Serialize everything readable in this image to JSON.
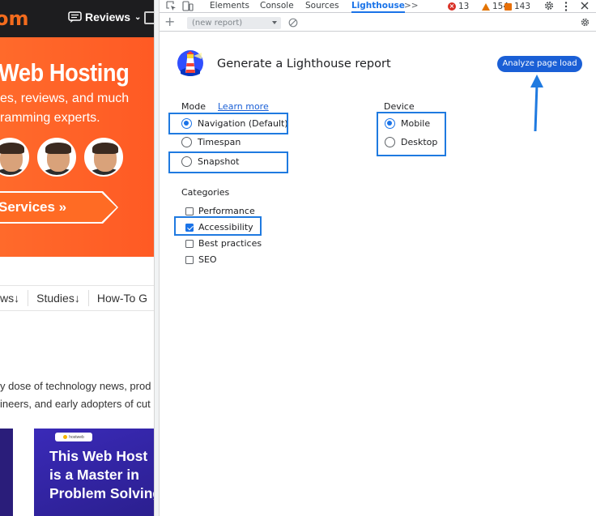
{
  "website": {
    "logo": "om",
    "nav_reviews": "Reviews",
    "hero_title": "Web Hosting",
    "hero_line1": "es, reviews, and much",
    "hero_line2": "ramming experts.",
    "services_button": "Services »",
    "subnav": [
      "ws↓",
      "Studies↓",
      "How-To G"
    ],
    "text_line1": "y dose of technology news, prod",
    "text_line2": "ineers, and early adopters of cut",
    "card_badge": "hostweb",
    "card_title": "This Web Host is a Master in Problem Solving"
  },
  "devtools": {
    "tabs": {
      "elements": "Elements",
      "console": "Console",
      "sources": "Sources",
      "lighthouse": "Lighthouse",
      "more": ">>"
    },
    "counts": {
      "errors": "13",
      "warnings": "154",
      "issues": "143"
    },
    "toolbar": {
      "plus": "+",
      "report_select": "(new report)"
    },
    "lighthouse": {
      "title": "Generate a Lighthouse report",
      "analyze_button": "Analyze page load",
      "mode_label": "Mode",
      "learn_more": "Learn more",
      "device_label": "Device",
      "modes": [
        {
          "label": "Navigation (Default)",
          "checked": true
        },
        {
          "label": "Timespan",
          "checked": false
        },
        {
          "label": "Snapshot",
          "checked": false
        }
      ],
      "devices": [
        {
          "label": "Mobile",
          "checked": true
        },
        {
          "label": "Desktop",
          "checked": false
        }
      ],
      "categories_label": "Categories",
      "categories": [
        {
          "label": "Performance",
          "checked": false
        },
        {
          "label": "Accessibility",
          "checked": true
        },
        {
          "label": "Best practices",
          "checked": false
        },
        {
          "label": "SEO",
          "checked": false
        }
      ]
    },
    "colors": {
      "accent": "#1a73e8",
      "highlight": "#1f7ae0",
      "button": "#1a5fd6"
    }
  }
}
